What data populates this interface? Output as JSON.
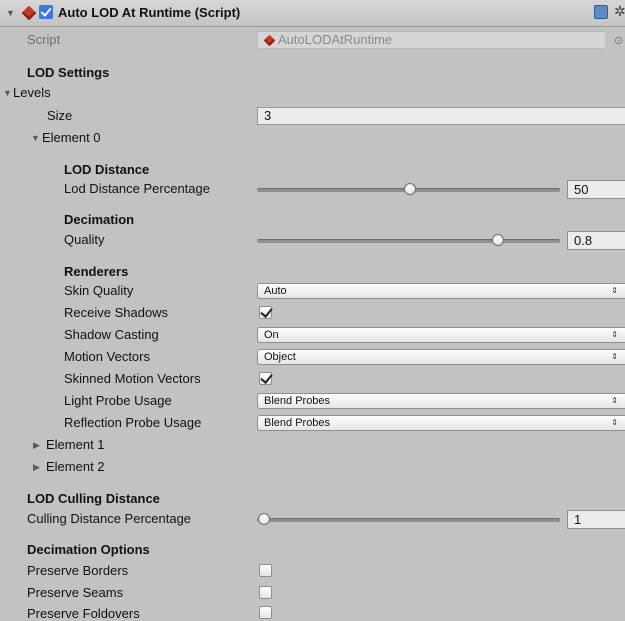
{
  "header": {
    "title": "Auto LOD At Runtime (Script)",
    "enabled": true
  },
  "script_row": {
    "label": "Script",
    "value": "AutoLODAtRuntime"
  },
  "lod_settings": {
    "heading": "LOD Settings"
  },
  "levels": {
    "label": "Levels",
    "size_label": "Size",
    "size_value": "3",
    "element0": {
      "label": "Element 0",
      "lod_distance": {
        "heading": "LOD Distance",
        "label": "Lod Distance Percentage",
        "value": "50",
        "slider_fraction": 0.5
      },
      "decimation": {
        "heading": "Decimation",
        "label": "Quality",
        "value": "0.8",
        "slider_fraction": 0.8
      },
      "renderers": {
        "heading": "Renderers",
        "skin_quality_label": "Skin Quality",
        "skin_quality_value": "Auto",
        "receive_shadows_label": "Receive Shadows",
        "receive_shadows": true,
        "shadow_casting_label": "Shadow Casting",
        "shadow_casting_value": "On",
        "motion_vectors_label": "Motion Vectors",
        "motion_vectors_value": "Object",
        "skinned_motion_vectors_label": "Skinned Motion Vectors",
        "skinned_motion_vectors": true,
        "light_probe_label": "Light Probe Usage",
        "light_probe_value": "Blend Probes",
        "reflection_probe_label": "Reflection Probe Usage",
        "reflection_probe_value": "Blend Probes"
      }
    },
    "element1": {
      "label": "Element 1"
    },
    "element2": {
      "label": "Element 2"
    }
  },
  "culling": {
    "heading": "LOD Culling Distance",
    "label": "Culling Distance Percentage",
    "value": "1",
    "slider_fraction": 0.01
  },
  "decimation_options": {
    "heading": "Decimation Options",
    "preserve_borders_label": "Preserve Borders",
    "preserve_borders": false,
    "preserve_seams_label": "Preserve Seams",
    "preserve_seams": false,
    "preserve_foldovers_label": "Preserve Foldovers",
    "preserve_foldovers": false
  },
  "icons": {
    "foldout": "triangle",
    "component": "cube-icon",
    "help": "book-icon",
    "settings": "gear-icon",
    "object_picker": "target-icon"
  }
}
